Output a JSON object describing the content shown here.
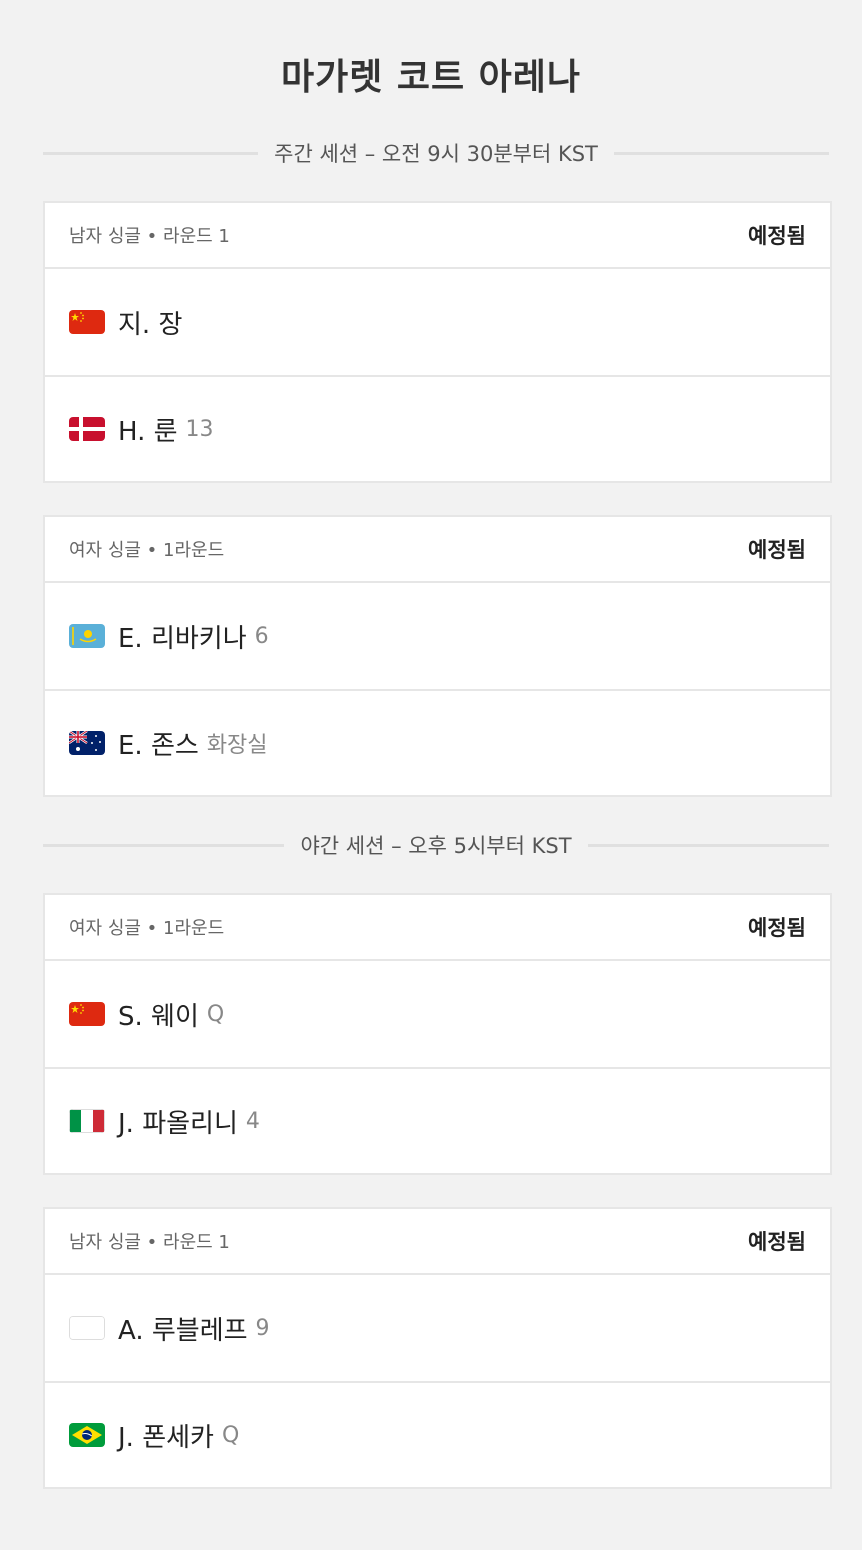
{
  "venue": {
    "title": "마가렛 코트 아레나"
  },
  "sessions": [
    {
      "label": "주간 세션 – 오전 9시 30분부터 KST",
      "matches": [
        {
          "meta": "남자 싱글 • 라운드 1",
          "status": "예정됨",
          "players": [
            {
              "flag": "china-flag",
              "name": "지. 장",
              "seed": ""
            },
            {
              "flag": "denmark-flag",
              "name": "H. 룬",
              "seed": "13"
            }
          ]
        },
        {
          "meta": "여자 싱글 • 1라운드",
          "status": "예정됨",
          "players": [
            {
              "flag": "kazakhstan-flag",
              "name": "E. 리바키나",
              "seed": "6"
            },
            {
              "flag": "australia-flag",
              "name": "E. 존스",
              "seed": "화장실"
            }
          ]
        }
      ]
    },
    {
      "label": "야간 세션 – 오후 5시부터 KST",
      "matches": [
        {
          "meta": "여자 싱글 • 1라운드",
          "status": "예정됨",
          "players": [
            {
              "flag": "china-flag",
              "name": "S. 웨이",
              "seed": "Q"
            },
            {
              "flag": "italy-flag",
              "name": "J. 파올리니",
              "seed": "4"
            }
          ]
        },
        {
          "meta": "남자 싱글 • 라운드 1",
          "status": "예정됨",
          "players": [
            {
              "flag": "blank-flag",
              "name": "A. 루블레프",
              "seed": "9"
            },
            {
              "flag": "brazil-flag",
              "name": "J. 폰세카",
              "seed": "Q"
            }
          ]
        }
      ]
    }
  ],
  "colors": {
    "background": "#f2f2f2",
    "card": "#ffffff",
    "border": "#e6e6e6",
    "china_red": "#de2910",
    "denmark_red": "#c8102e",
    "kazakhstan_blue": "#5ab0d8",
    "australia_blue": "#012169",
    "italy_green": "#009246",
    "italy_red": "#ce2b37",
    "brazil_green": "#009c3b",
    "brazil_yellow": "#ffdf00"
  }
}
